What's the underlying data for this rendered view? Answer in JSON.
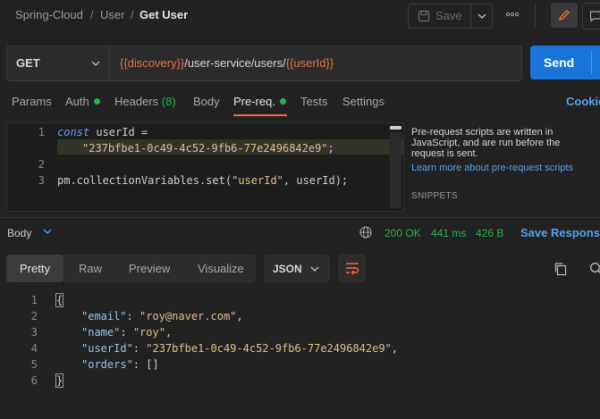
{
  "breadcrumb": {
    "items": [
      "Spring-Cloud",
      "User"
    ],
    "current": "Get User",
    "separator": "/"
  },
  "toolbar": {
    "save_label": "Save",
    "more_label": "ooo"
  },
  "request": {
    "method": "GET",
    "url_parts": [
      {
        "text": "{{discovery}}",
        "is_var": true
      },
      {
        "text": "/user-service/users/",
        "is_var": false
      },
      {
        "text": "{{userId}}",
        "is_var": true
      }
    ],
    "send_label": "Send"
  },
  "request_tabs": {
    "params": "Params",
    "auth": "Auth",
    "headers": "Headers",
    "headers_count": "(8)",
    "body": "Body",
    "prereq": "Pre-req.",
    "tests": "Tests",
    "settings": "Settings",
    "cookies": "Cookie",
    "active": "Pre-req."
  },
  "editor": {
    "line_numbers": [
      "1",
      "",
      "2",
      "3"
    ],
    "line1_kw": "const",
    "line1_rest": " userId =",
    "line1b_str": "\"237bfbe1-0c49-4c52-9fb6-77e2496842e9\"",
    "line1b_end": ";",
    "line3_a": "pm.collectionVariables.",
    "line3_fn": "set",
    "line3_b": "(",
    "line3_str": "\"userId\"",
    "line3_c": ", userId);"
  },
  "help": {
    "text": "Pre-request scripts are written in JavaScript, and are run before the request is sent.",
    "link": "Learn more about pre-request scripts",
    "snippets": "SNIPPETS"
  },
  "response": {
    "body_label": "Body",
    "status": "200 OK",
    "time": "441 ms",
    "size": "426 B",
    "save_label": "Save Response",
    "tabs": [
      "Pretty",
      "Raw",
      "Preview",
      "Visualize"
    ],
    "active_tab": "Pretty",
    "format": "JSON",
    "line_numbers": [
      "1",
      "2",
      "3",
      "4",
      "5",
      "6"
    ],
    "json": {
      "open": "{",
      "close": "}",
      "email_key": "\"email\"",
      "email_val": "\"roy@naver.com\"",
      "name_key": "\"name\"",
      "name_val": "\"roy\"",
      "userId_key": "\"userId\"",
      "userId_val": "\"237bfbe1-0c49-4c52-9fb6-77e2496842e9\"",
      "orders_key": "\"orders\"",
      "orders_val": "[]"
    }
  },
  "colors": {
    "accent": "#ff6c37",
    "link": "#5aa0ef",
    "success": "#2bb24c",
    "send": "#1a73d9",
    "variable": "#ec6f42"
  },
  "icons": [
    "chevron-down-icon",
    "more-icon",
    "pencil-icon",
    "comment-icon",
    "globe-icon",
    "wrap-icon",
    "copy-icon",
    "search-icon"
  ]
}
